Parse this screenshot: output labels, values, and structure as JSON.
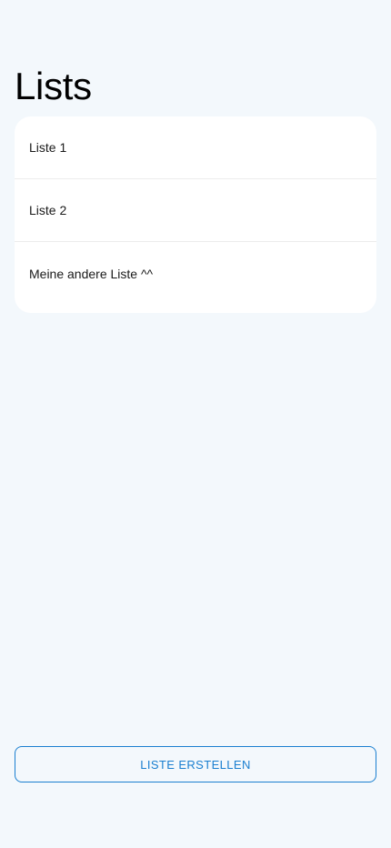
{
  "header": {
    "title": "Lists"
  },
  "lists": {
    "items": [
      {
        "label": "Liste 1"
      },
      {
        "label": "Liste 2"
      },
      {
        "label": "Meine andere Liste ^^"
      }
    ]
  },
  "actions": {
    "create_label": "LISTE ERSTELLEN"
  },
  "colors": {
    "background": "#f3f8fc",
    "card": "#ffffff",
    "accent": "#1a7fd0"
  }
}
